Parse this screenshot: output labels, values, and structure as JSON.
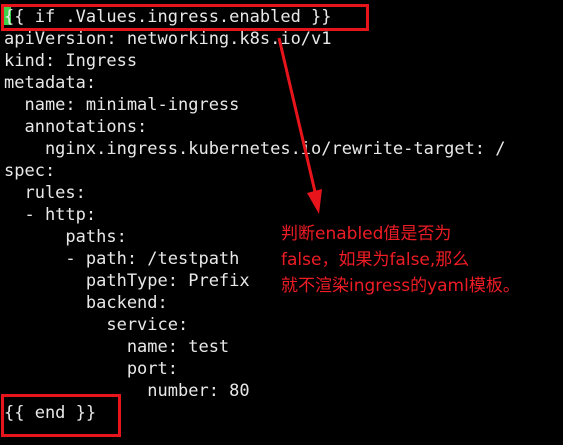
{
  "code": {
    "lines": [
      "{{ if .Values.ingress.enabled }}",
      "apiVersion: networking.k8s.io/v1",
      "kind: Ingress",
      "metadata:",
      "  name: minimal-ingress",
      "  annotations:",
      "    nginx.ingress.kubernetes.io/rewrite-target: /",
      "spec:",
      "  rules:",
      "  - http:",
      "      paths:",
      "      - path: /testpath",
      "        pathType: Prefix",
      "        backend:",
      "          service:",
      "            name: test",
      "            port:",
      "              number: 80",
      "{{ end }}"
    ]
  },
  "annotation": {
    "lines": [
      "判断enabled值是否为",
      "false，如果为false,那么",
      "就不渲染ingress的yaml模板。"
    ]
  },
  "colors": {
    "background": "#000000",
    "code_text": "#e8e8e8",
    "cursor": "#3cd24a",
    "highlight_box": "#e8141c",
    "annotation_text": "#ee1c24"
  }
}
